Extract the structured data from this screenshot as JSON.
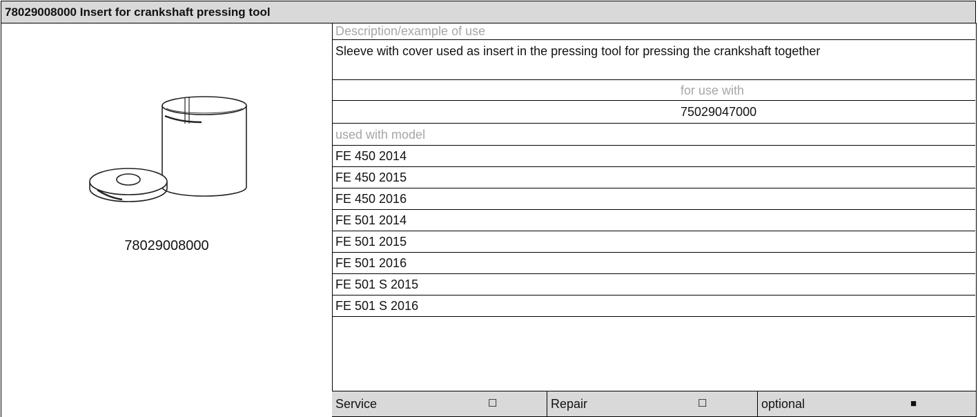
{
  "title": "78029008000 Insert for crankshaft pressing tool",
  "image": {
    "caption": "78029008000",
    "icon": "sleeve-and-cover-illustration"
  },
  "description": {
    "label": "Description/example of use",
    "text": "Sleeve with cover used as insert in the pressing tool for pressing the crankshaft together"
  },
  "for_use_with": {
    "label": "for use with",
    "value": "75029047000"
  },
  "models": {
    "label": "used with model",
    "items": [
      "FE 450 2014",
      "FE 450 2015",
      "FE 450 2016",
      "FE 501 2014",
      "FE 501 2015",
      "FE 501 2016",
      "FE 501 S 2015",
      "FE 501 S 2016"
    ]
  },
  "footer": {
    "service_label": "Service",
    "service_mark": "☐",
    "repair_label": "Repair",
    "repair_mark": "☐",
    "optional_label": "optional",
    "optional_mark": "■"
  },
  "colors": {
    "header_bg": "#d9d9d9",
    "muted_text": "#a6a6a6"
  }
}
